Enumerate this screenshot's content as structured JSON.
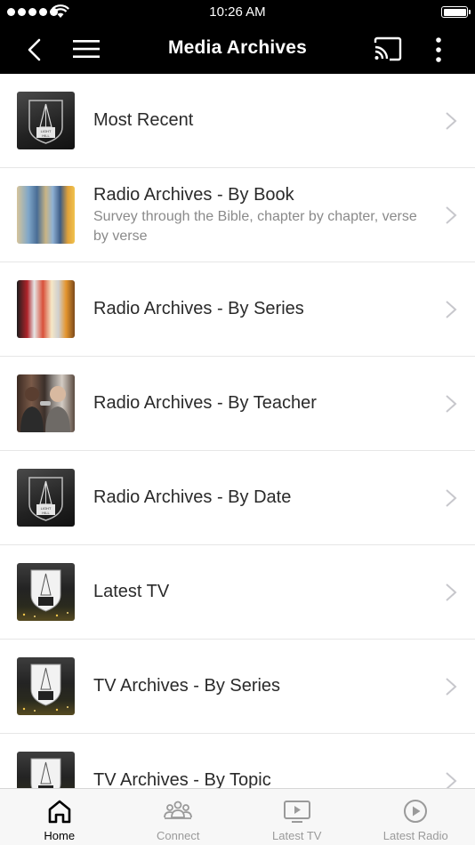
{
  "status_bar": {
    "time": "10:26 AM"
  },
  "nav": {
    "title": "Media Archives"
  },
  "rows": [
    {
      "title": "Most Recent",
      "subtitle": ""
    },
    {
      "title": "Radio Archives - By Book",
      "subtitle": "Survey through the Bible, chapter by chapter, verse by verse"
    },
    {
      "title": "Radio Archives - By Series",
      "subtitle": ""
    },
    {
      "title": "Radio Archives - By Teacher",
      "subtitle": ""
    },
    {
      "title": "Radio Archives - By Date",
      "subtitle": ""
    },
    {
      "title": "Latest TV",
      "subtitle": ""
    },
    {
      "title": "TV Archives - By Series",
      "subtitle": ""
    },
    {
      "title": "TV Archives - By Topic",
      "subtitle": ""
    }
  ],
  "tabs": [
    {
      "label": "Home",
      "icon": "home-icon",
      "active": true
    },
    {
      "label": "Connect",
      "icon": "people-icon",
      "active": false
    },
    {
      "label": "Latest TV",
      "icon": "tv-icon",
      "active": false
    },
    {
      "label": "Latest Radio",
      "icon": "play-circle-icon",
      "active": false
    }
  ],
  "colors": {
    "header_bg": "#000000",
    "active_tab": "#000000",
    "inactive_tab": "#9a9a9a"
  }
}
